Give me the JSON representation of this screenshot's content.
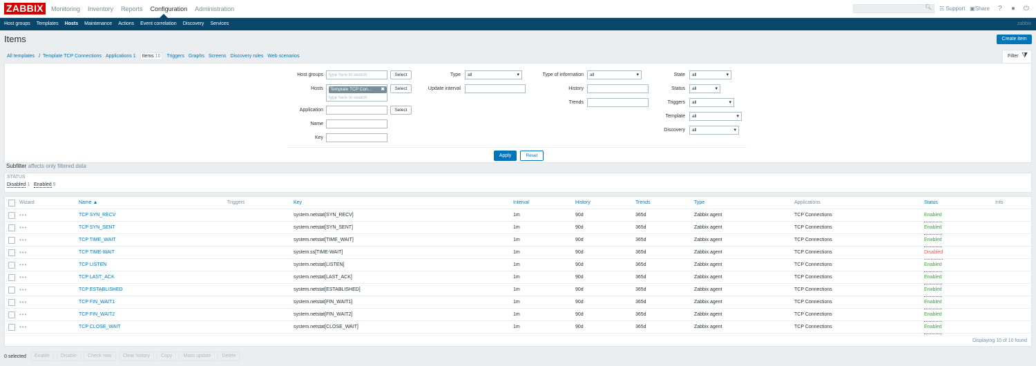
{
  "app": {
    "logo": "ZABBIX"
  },
  "main_menu": [
    "Monitoring",
    "Inventory",
    "Reports",
    "Configuration",
    "Administration"
  ],
  "main_menu_selected": "Configuration",
  "top_right": {
    "support": "Support",
    "share": "Share",
    "help": "?"
  },
  "sub_menu": [
    "Host groups",
    "Templates",
    "Hosts",
    "Maintenance",
    "Actions",
    "Event correlation",
    "Discovery",
    "Services"
  ],
  "sub_menu_selected": "Hosts",
  "sub_right": "zabbix",
  "page": {
    "title": "Items",
    "create_button": "Create item"
  },
  "breadcrumbs": {
    "all_templates": "All templates",
    "sep": "/",
    "template": "Template TCP Connections",
    "applications": "Applications 1",
    "items_label": "Items",
    "items_count": "10",
    "triggers": "Triggers",
    "graphs": "Graphs",
    "screens": "Screens",
    "discovery_rules": "Discovery rules",
    "web_scenarios": "Web scenarios"
  },
  "filter": {
    "tab_label": "Filter",
    "host_groups_label": "Host groups",
    "host_groups_placeholder": "type here to search",
    "hosts_label": "Hosts",
    "hosts_chip": "Template TCP Con...",
    "hosts_placeholder": "type here to search",
    "application_label": "Application",
    "name_label": "Name",
    "key_label": "Key",
    "select_label": "Select",
    "type_label": "Type",
    "type_value": "all",
    "update_interval_label": "Update interval",
    "type_info_label": "Type of information",
    "type_info_value": "all",
    "history_label": "History",
    "trends_label": "Trends",
    "state_label": "State",
    "state_value": "all",
    "status_label": "Status",
    "status_value": "all",
    "triggers_label": "Triggers",
    "triggers_value": "all",
    "template_label": "Template",
    "template_value": "all",
    "discovery_label": "Discovery",
    "discovery_value": "all",
    "apply": "Apply",
    "reset": "Reset"
  },
  "subfilter": {
    "title": "Subfilter",
    "note": "affects only filtered data",
    "status_heading": "STATUS",
    "disabled_label": "Disabled",
    "disabled_count": "1",
    "enabled_label": "Enabled",
    "enabled_count": "9"
  },
  "table": {
    "headers": {
      "wizard": "Wizard",
      "name": "Name ▲",
      "triggers": "Triggers",
      "key": "Key",
      "interval": "Interval",
      "history": "History",
      "trends": "Trends",
      "type": "Type",
      "applications": "Applications",
      "status": "Status",
      "info": "Info"
    },
    "rows": [
      {
        "name": "TCP SYN_RECV",
        "key": "system.netstat[SYN_RECV]",
        "interval": "1m",
        "history": "90d",
        "trends": "365d",
        "type": "Zabbix agent",
        "applications": "TCP Connections",
        "status": "Enabled"
      },
      {
        "name": "TCP SYN_SENT",
        "key": "system.netstat[SYN_SENT]",
        "interval": "1m",
        "history": "90d",
        "trends": "365d",
        "type": "Zabbix agent",
        "applications": "TCP Connections",
        "status": "Enabled"
      },
      {
        "name": "TCP TIME_WAIT",
        "key": "system.netstat[TIME_WAIT]",
        "interval": "1m",
        "history": "90d",
        "trends": "365d",
        "type": "Zabbix agent",
        "applications": "TCP Connections",
        "status": "Enabled"
      },
      {
        "name": "TCP TIME-WAIT",
        "key": "system.ss[TIME-WAIT]",
        "interval": "1m",
        "history": "90d",
        "trends": "365d",
        "type": "Zabbix agent",
        "applications": "TCP Connections",
        "status": "Disabled"
      },
      {
        "name": "TCP LISTEN",
        "key": "system.netstat[LISTEN]",
        "interval": "1m",
        "history": "90d",
        "trends": "365d",
        "type": "Zabbix agent",
        "applications": "TCP Connections",
        "status": "Enabled"
      },
      {
        "name": "TCP LAST_ACK",
        "key": "system.netstat[LAST_ACK]",
        "interval": "1m",
        "history": "90d",
        "trends": "365d",
        "type": "Zabbix agent",
        "applications": "TCP Connections",
        "status": "Enabled"
      },
      {
        "name": "TCP ESTABLISHED",
        "key": "system.netstat[ESTABLISHED]",
        "interval": "1m",
        "history": "90d",
        "trends": "365d",
        "type": "Zabbix agent",
        "applications": "TCP Connections",
        "status": "Enabled"
      },
      {
        "name": "TCP FIN_WAIT1",
        "key": "system.netstat[FIN_WAIT1]",
        "interval": "1m",
        "history": "90d",
        "trends": "365d",
        "type": "Zabbix agent",
        "applications": "TCP Connections",
        "status": "Enabled"
      },
      {
        "name": "TCP FIN_WAIT2",
        "key": "system.netstat[FIN_WAIT2]",
        "interval": "1m",
        "history": "90d",
        "trends": "365d",
        "type": "Zabbix agent",
        "applications": "TCP Connections",
        "status": "Enabled"
      },
      {
        "name": "TCP CLOSE_WAIT",
        "key": "system.netstat[CLOSE_WAIT]",
        "interval": "1m",
        "history": "90d",
        "trends": "365d",
        "type": "Zabbix agent",
        "applications": "TCP Connections",
        "status": "Enabled"
      }
    ],
    "wizard_icon": "•••",
    "footer": "Displaying 10 of 10 found"
  },
  "bottom_bar": {
    "selected": "0 selected",
    "buttons": [
      "Enable",
      "Disable",
      "Check now",
      "Clear history",
      "Copy",
      "Mass update",
      "Delete"
    ]
  },
  "colors": {
    "enabled": "#429e47",
    "disabled": "#e45959",
    "brand": "#d40000",
    "nav": "#0a466a",
    "accent": "#0275b8"
  }
}
